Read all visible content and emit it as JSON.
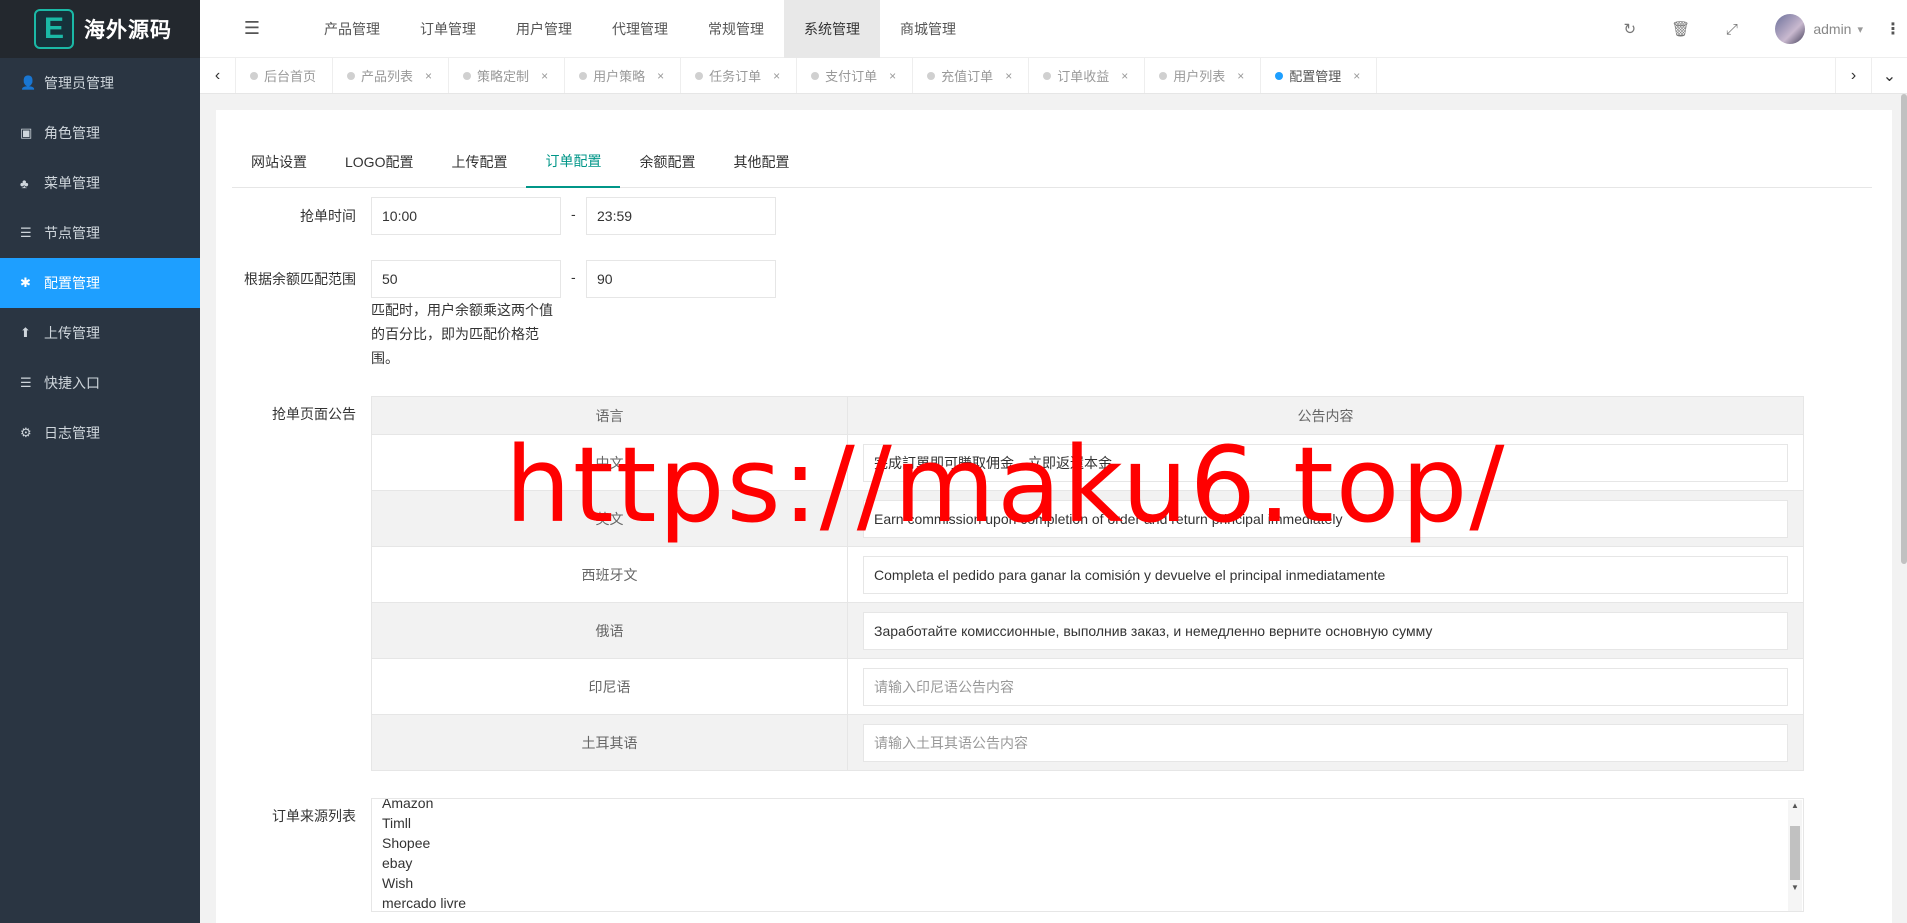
{
  "app": {
    "logo_letter": "E",
    "logo_text": "海外源码"
  },
  "sidebar": {
    "items": [
      {
        "icon": "user-icon",
        "glyph": "👤",
        "label": "管理员管理"
      },
      {
        "icon": "role-icon",
        "glyph": "▣",
        "label": "角色管理"
      },
      {
        "icon": "tree-icon",
        "glyph": "♣",
        "label": "菜单管理"
      },
      {
        "icon": "list-icon",
        "glyph": "☰",
        "label": "节点管理"
      },
      {
        "icon": "asterisk-icon",
        "glyph": "✱",
        "label": "配置管理",
        "active": true
      },
      {
        "icon": "upload-icon",
        "glyph": "⬆",
        "label": "上传管理"
      },
      {
        "icon": "list-icon",
        "glyph": "☰",
        "label": "快捷入口"
      },
      {
        "icon": "log-icon",
        "glyph": "⚙",
        "label": "日志管理"
      }
    ]
  },
  "header": {
    "menu_glyph": "☰",
    "nav": [
      "产品管理",
      "订单管理",
      "用户管理",
      "代理管理",
      "常规管理",
      "系统管理",
      "商城管理"
    ],
    "active_nav": "系统管理",
    "icons": {
      "refresh": "↻",
      "trash": "🗑",
      "fullscreen": "⤢"
    },
    "user": "admin",
    "caret": "▾",
    "more": "⋮"
  },
  "tabs": {
    "left_arrow": "‹",
    "right_arrow": "›",
    "collapse": "⌄",
    "close_glyph": "×",
    "items": [
      {
        "label": "后台首页",
        "closable": false
      },
      {
        "label": "产品列表",
        "closable": true
      },
      {
        "label": "策略定制",
        "closable": true
      },
      {
        "label": "用户策略",
        "closable": true
      },
      {
        "label": "任务订单",
        "closable": true
      },
      {
        "label": "支付订单",
        "closable": true
      },
      {
        "label": "充值订单",
        "closable": true
      },
      {
        "label": "订单收益",
        "closable": true
      },
      {
        "label": "用户列表",
        "closable": true
      },
      {
        "label": "配置管理",
        "closable": true,
        "active": true
      }
    ]
  },
  "config_tabs": [
    "网站设置",
    "LOGO配置",
    "上传配置",
    "订单配置",
    "余额配置",
    "其他配置"
  ],
  "active_config_tab": "订单配置",
  "form": {
    "grab_time": {
      "label": "抢单时间",
      "start": "10:00",
      "end": "23:59",
      "sep": "-"
    },
    "balance_range": {
      "label": "根据余额匹配范围",
      "min": "50",
      "max": "90",
      "sep": "-",
      "hint": "匹配时，用户余额乘这两个值的百分比，即为匹配价格范围。"
    },
    "announcement": {
      "label": "抢单页面公告",
      "col_lang": "语言",
      "col_content": "公告内容",
      "rows": [
        {
          "lang": "中文",
          "value": "完成訂單即可賺取佣金，立即返還本金",
          "placeholder": ""
        },
        {
          "lang": "英文",
          "value": "Earn commission upon completion of order and return principal immediately",
          "placeholder": ""
        },
        {
          "lang": "西班牙文",
          "value": "Completa el pedido para ganar la comisión y devuelve el principal inmediatamente",
          "placeholder": ""
        },
        {
          "lang": "俄语",
          "value": "Заработайте комиссионные, выполнив заказ, и немедленно верните основную сумму",
          "placeholder": ""
        },
        {
          "lang": "印尼语",
          "value": "",
          "placeholder": "请输入印尼语公告内容"
        },
        {
          "lang": "土耳其语",
          "value": "",
          "placeholder": "请输入土耳其语公告内容"
        }
      ]
    },
    "order_sources": {
      "label": "订单来源列表",
      "lines": [
        "Amazon",
        "Timll",
        "Shopee",
        "ebay",
        "Wish",
        "mercado livre"
      ]
    }
  },
  "watermark": "https://maku6.top/"
}
